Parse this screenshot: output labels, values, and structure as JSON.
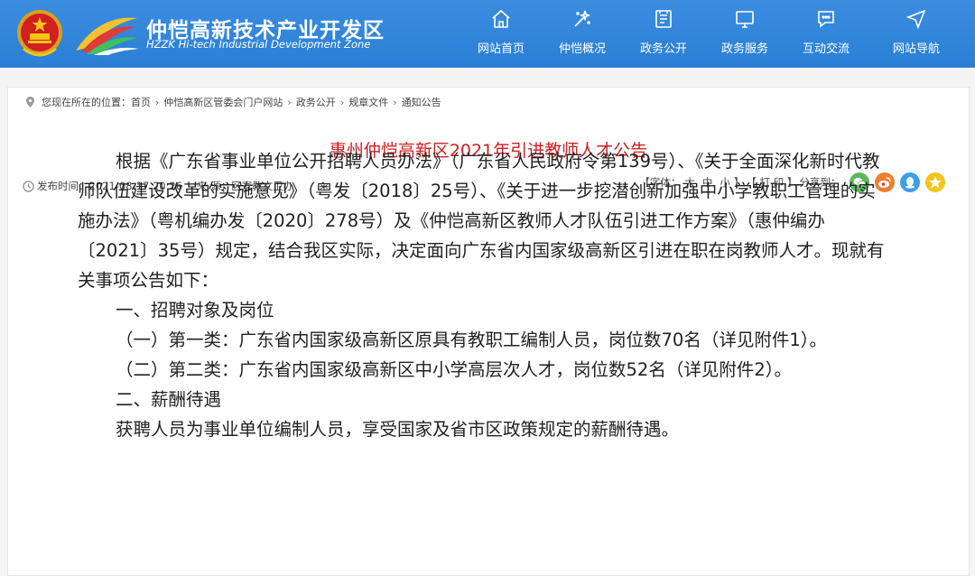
{
  "header": {
    "site_title": "仲恺高新技术产业开发区",
    "site_subtitle": "HZZK Hi-tech Industrial Development Zone",
    "nav": [
      {
        "label": "网站首页",
        "icon": "home-icon"
      },
      {
        "label": "仲恺概况",
        "icon": "overview-icon"
      },
      {
        "label": "政务公开",
        "icon": "open-government-icon"
      },
      {
        "label": "政务服务",
        "icon": "service-monitor-icon"
      },
      {
        "label": "互动交流",
        "icon": "chat-icon"
      },
      {
        "label": "网站导航",
        "icon": "navigation-icon"
      }
    ],
    "colors": {
      "bar": "#2e84d8",
      "text": "#ffffff"
    }
  },
  "breadcrumb": {
    "prefix": "您现在所在的位置：",
    "items": [
      "首页",
      "仲恺高新区管委会门户网站",
      "政务公开",
      "规章文件",
      "通知公告"
    ],
    "separator": "›"
  },
  "article": {
    "title": "惠州仲恺高新区2021年引进教师人才公告",
    "publish_label": "发布时间：",
    "publish_time": "2021-08-17 20:26",
    "source_label": "来 源：",
    "source": "区宣教文卫办",
    "title_color": "#cf1f1f",
    "paragraphs": [
      "根据《广东省事业单位公开招聘人员办法》（广东省人民政府令第139号）、《关于全面深化新时代教师队伍建设改革的实施意见》（粤发〔2018〕25号）、《关于进一步挖潜创新加强中小学教职工管理的实施办法》（粤机编办发〔2020〕278号）及《仲恺高新区教师人才队伍引进工作方案》（惠仲编办〔2021〕35号）规定，结合我区实际，决定面向广东省内国家级高新区引进在职在岗教师人才。现就有关事项公告如下：",
      "一、招聘对象及岗位",
      "（一）第一类：广东省内国家级高新区原具有教职工编制人员，岗位数70名（详见附件1）。",
      "（二）第二类：广东省内国家级高新区中小学高层次人才，岗位数52名（详见附件2）。",
      "二、薪酬待遇",
      "获聘人员为事业单位编制人员，享受国家及省市区政策规定的薪酬待遇。"
    ]
  },
  "tools": {
    "font_label": "【字体：",
    "size_large": "大",
    "size_medium": "中",
    "size_small": "小",
    "font_close": "】",
    "print_label": "【 打 印 】",
    "share_label": "分享到：",
    "share_icons": [
      "wechat-icon",
      "weibo-icon",
      "qq-icon",
      "qzone-icon"
    ]
  }
}
